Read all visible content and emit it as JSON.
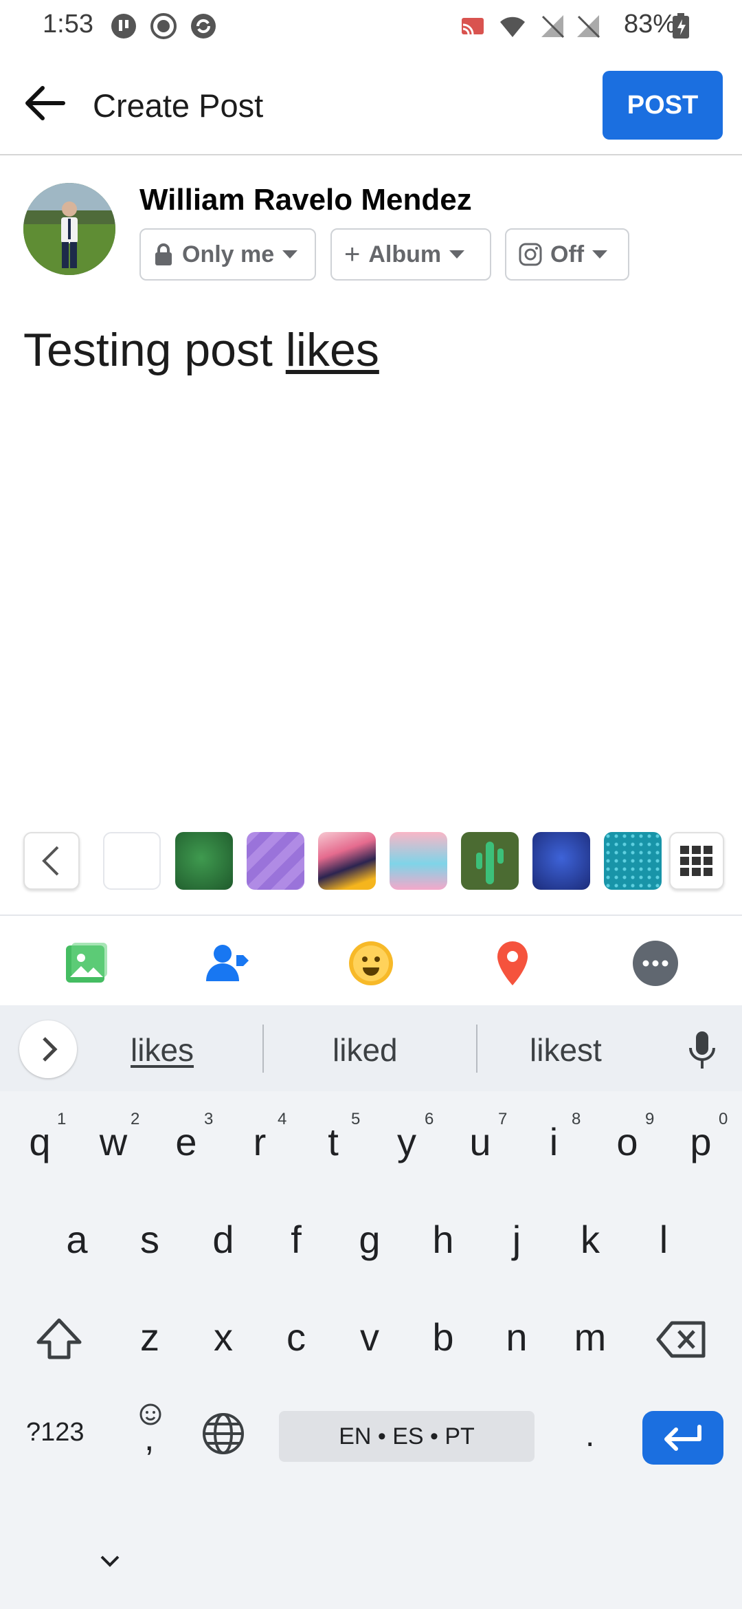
{
  "status": {
    "time": "1:53",
    "battery": "83%"
  },
  "header": {
    "title": "Create Post",
    "post_label": "POST"
  },
  "user": {
    "name": "William Ravelo Mendez"
  },
  "audience": {
    "privacy": "Only me",
    "album": "Album",
    "instagram": "Off"
  },
  "composer": {
    "text_plain": "Testing post ",
    "text_underlined": "likes"
  },
  "backgrounds": [
    "white",
    "green-ball",
    "purple-stripes",
    "abstract-faces",
    "pastel-wave",
    "cactus",
    "blue-ball",
    "teal-dots"
  ],
  "actions": [
    "photo-icon",
    "tag-people-icon",
    "feeling-icon",
    "location-icon",
    "more-icon"
  ],
  "keyboard": {
    "suggestions": [
      "likes",
      "liked",
      "likest"
    ],
    "row1": [
      "q",
      "w",
      "e",
      "r",
      "t",
      "y",
      "u",
      "i",
      "o",
      "p"
    ],
    "row1_hints": [
      "1",
      "2",
      "3",
      "4",
      "5",
      "6",
      "7",
      "8",
      "9",
      "0"
    ],
    "row2": [
      "a",
      "s",
      "d",
      "f",
      "g",
      "h",
      "j",
      "k",
      "l"
    ],
    "row3": [
      "z",
      "x",
      "c",
      "v",
      "b",
      "n",
      "m"
    ],
    "symbols_label": "?123",
    "comma": ",",
    "period": ".",
    "space_label": "EN • ES • PT"
  }
}
